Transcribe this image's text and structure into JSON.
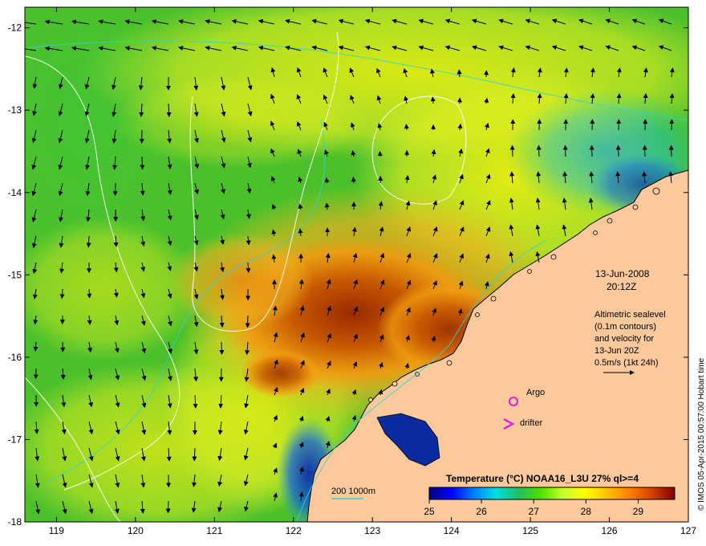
{
  "map": {
    "lon_range": [
      118.6,
      127
    ],
    "lat_range": [
      -18,
      -11.75
    ],
    "lon_ticks": [
      "119",
      "120",
      "121",
      "122",
      "123",
      "124",
      "125",
      "126",
      "127"
    ],
    "lat_ticks": [
      "-12",
      "-13",
      "-14",
      "-15",
      "-16",
      "-17",
      "-18"
    ],
    "land_color": "#fbc99b",
    "contour_color": "#ffffff",
    "isobath_color": "#2fd4d4"
  },
  "annotation": {
    "date": "13-Jun-2008",
    "time": "20:12Z",
    "altimetry_lines": [
      "Altimetric sealevel",
      "(0.1m contours)",
      "and velocity for",
      "13-Jun 20Z",
      "0.5m/s (1kt 24h)"
    ]
  },
  "legend": {
    "argo_label": "Argo",
    "drifter_label": "drifter",
    "argo_color": "#e020e0",
    "drifter_color": "#e020e0"
  },
  "bathymetry_legend": {
    "label": "200  1000m"
  },
  "colorbar": {
    "title": "Temperature (°C) NOAA16_L3U 27% ql>=4",
    "ticks": [
      "25",
      "26",
      "27",
      "28",
      "29"
    ],
    "range": [
      25,
      29.7
    ],
    "stops": [
      "#00007f",
      "#0000ff",
      "#0080ff",
      "#00e0e0",
      "#20c060",
      "#50e000",
      "#c8ff30",
      "#ffff00",
      "#ffc000",
      "#ff7f00",
      "#d04000",
      "#7f0000"
    ]
  },
  "credit": "© IMOS 05-Apr-2015 00:57:00 Hobart time"
}
